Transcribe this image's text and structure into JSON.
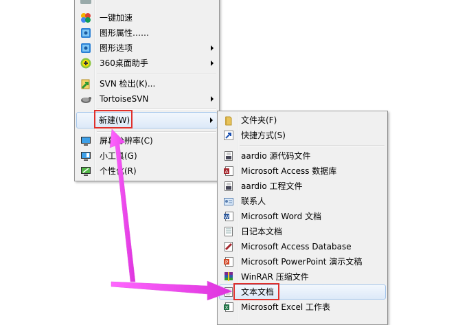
{
  "colors": {
    "menu_bg": "#f0f0f0",
    "highlight_border": "#a8c8ec",
    "annotation_red": "#e0302c",
    "annotation_arrow": "#ee44ee"
  },
  "menu1": {
    "items": [
      {
        "label": "一键加速",
        "icon": "speed-boost-icon"
      },
      {
        "label": "图形属性……",
        "icon": "graphics-properties-icon"
      },
      {
        "label": "图形选项",
        "icon": "graphics-options-icon",
        "submenu": true
      },
      {
        "label": "360桌面助手",
        "icon": "360-desktop-icon",
        "submenu": true
      },
      {
        "label": "SVN 检出(K)...",
        "icon": "svn-checkout-icon"
      },
      {
        "label": "TortoiseSVN",
        "icon": "tortoise-svn-icon",
        "submenu": true
      },
      {
        "label": "新建(W)",
        "icon": "",
        "submenu": true
      },
      {
        "label": "屏幕分辨率(C)",
        "icon": "screen-resolution-icon"
      },
      {
        "label": "小工具(G)",
        "icon": "gadgets-icon"
      },
      {
        "label": "个性化(R)",
        "icon": "personalize-icon"
      }
    ]
  },
  "menu2": {
    "items": [
      {
        "label": "文件夹(F)",
        "icon": "folder-icon"
      },
      {
        "label": "快捷方式(S)",
        "icon": "shortcut-icon"
      },
      {
        "label": "aardio 源代码文件",
        "icon": "aardio-source-icon"
      },
      {
        "label": "Microsoft Access 数据库",
        "icon": "access-db-icon"
      },
      {
        "label": "aardio 工程文件",
        "icon": "aardio-project-icon"
      },
      {
        "label": "联系人",
        "icon": "contact-icon"
      },
      {
        "label": "Microsoft Word 文档",
        "icon": "word-doc-icon"
      },
      {
        "label": "日记本文档",
        "icon": "journal-icon"
      },
      {
        "label": "Microsoft Access Database",
        "icon": "access-database-icon"
      },
      {
        "label": "Microsoft PowerPoint 演示文稿",
        "icon": "powerpoint-icon"
      },
      {
        "label": "WinRAR 压缩文件",
        "icon": "winrar-icon"
      },
      {
        "label": "文本文档",
        "icon": "text-doc-icon"
      },
      {
        "label": "Microsoft Excel 工作表",
        "icon": "excel-icon"
      }
    ]
  }
}
